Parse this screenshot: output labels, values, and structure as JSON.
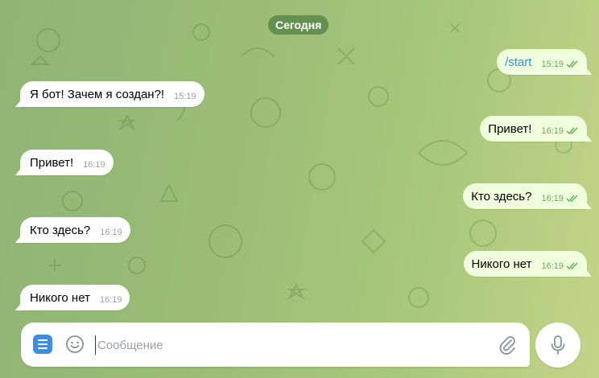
{
  "chat": {
    "date_separator": "Сегодня",
    "messages": [
      {
        "direction": "out",
        "text": "/start",
        "time": "15:19",
        "is_command": true,
        "read": true
      },
      {
        "direction": "in",
        "text": "Я бот! Зачем я создан?!",
        "time": "15:19"
      },
      {
        "direction": "out",
        "text": "Привет!",
        "time": "16:19",
        "read": true
      },
      {
        "direction": "in",
        "text": "Привет!",
        "time": "16:19"
      },
      {
        "direction": "out",
        "text": "Кто здесь?",
        "time": "16:19",
        "read": true
      },
      {
        "direction": "in",
        "text": "Кто здесь?",
        "time": "16:19"
      },
      {
        "direction": "out",
        "text": "Никого нет",
        "time": "16:19",
        "read": true
      },
      {
        "direction": "in",
        "text": "Никого нет",
        "time": "16:19"
      }
    ]
  },
  "composer": {
    "placeholder": "Сообщение",
    "value": ""
  },
  "icons": {
    "menu": "menu-icon",
    "emoji": "smiley-icon",
    "attach": "paperclip-icon",
    "mic": "microphone-icon",
    "read_receipt": "double-check-icon"
  },
  "colors": {
    "outgoing_bubble": "#effedd",
    "incoming_bubble": "#ffffff",
    "accent": "#3d8ee0",
    "command_text": "#3a8fd0",
    "date_chip": "#528046"
  }
}
